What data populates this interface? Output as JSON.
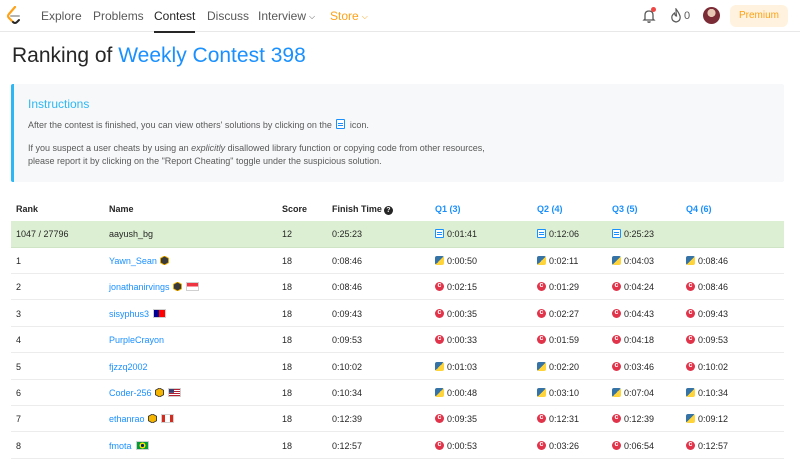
{
  "nav": {
    "items": [
      "Explore",
      "Problems",
      "Contest",
      "Discuss",
      "Interview",
      "Store"
    ],
    "streak_count": "0",
    "premium_label": "Premium"
  },
  "page": {
    "title_prefix": "Ranking of ",
    "title_contest": "Weekly Contest 398"
  },
  "instructions": {
    "heading": "Instructions",
    "line1_before": "After the contest is finished, you can view others' solutions by clicking on the",
    "line1_after": "icon.",
    "line2_before": "If you suspect a user cheats by using an",
    "line2_em": "explicitly",
    "line2_after": "disallowed library function or copying code from other resources,",
    "line3": "please report it by clicking on the \"Report Cheating\" toggle under the suspicious solution."
  },
  "table": {
    "headers": {
      "rank": "Rank",
      "name": "Name",
      "score": "Score",
      "finish": "Finish Time",
      "q1": "Q1 (3)",
      "q2": "Q2 (4)",
      "q3": "Q3 (5)",
      "q4": "Q4 (6)"
    },
    "me": {
      "rank": "1047 / 27796",
      "name": "aayush_bg",
      "score": "12",
      "finish": "0:25:23",
      "q1": "0:01:41",
      "q2": "0:12:06",
      "q3": "0:25:23",
      "q4": ""
    },
    "rows": [
      {
        "rank": "1",
        "name": "Yawn_Sean",
        "score": "18",
        "finish": "0:08:46",
        "q1": "0:00:50",
        "q2": "0:02:11",
        "q3": "0:04:03",
        "q4": "0:08:46"
      },
      {
        "rank": "2",
        "name": "jonathanirvings",
        "score": "18",
        "finish": "0:08:46",
        "q1": "0:02:15",
        "q2": "0:01:29",
        "q3": "0:04:24",
        "q4": "0:08:46"
      },
      {
        "rank": "3",
        "name": "sisyphus3",
        "score": "18",
        "finish": "0:09:43",
        "q1": "0:00:35",
        "q2": "0:02:27",
        "q3": "0:04:43",
        "q4": "0:09:43"
      },
      {
        "rank": "4",
        "name": "PurpleCrayon",
        "score": "18",
        "finish": "0:09:53",
        "q1": "0:00:33",
        "q2": "0:01:59",
        "q3": "0:04:18",
        "q4": "0:09:53"
      },
      {
        "rank": "5",
        "name": "fjzzq2002",
        "score": "18",
        "finish": "0:10:02",
        "q1": "0:01:03",
        "q2": "0:02:20",
        "q3": "0:03:46",
        "q4": "0:10:02"
      },
      {
        "rank": "6",
        "name": "Coder-256",
        "score": "18",
        "finish": "0:10:34",
        "q1": "0:00:48",
        "q2": "0:03:10",
        "q3": "0:07:04",
        "q4": "0:10:34"
      },
      {
        "rank": "7",
        "name": "ethanrao",
        "score": "18",
        "finish": "0:12:39",
        "q1": "0:09:35",
        "q2": "0:12:31",
        "q3": "0:12:39",
        "q4": "0:09:12"
      },
      {
        "rank": "8",
        "name": "fmota",
        "score": "18",
        "finish": "0:12:57",
        "q1": "0:00:53",
        "q2": "0:03:26",
        "q3": "0:06:54",
        "q4": "0:12:57"
      }
    ]
  }
}
